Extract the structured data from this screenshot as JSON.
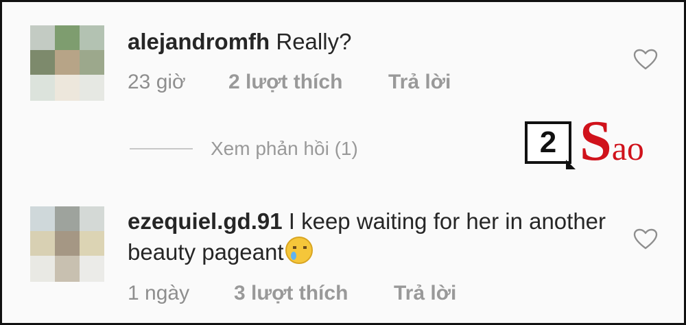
{
  "comments": [
    {
      "username": "alejandromfh",
      "text": "Really?",
      "time": "23 giờ",
      "likes": "2 lượt thích",
      "reply_label": "Trả lời",
      "avatar_colors": [
        "#c3cbc3",
        "#7e9d6f",
        "#b3c2b2",
        "#7d8a6c",
        "#b7a487",
        "#9ca88c",
        "#dce3dc",
        "#ede7dc",
        "#e6e8e3"
      ]
    },
    {
      "username": "ezequiel.gd.91",
      "text": "I keep waiting for her in another beauty pageant",
      "emoji": "crying-face",
      "time": "1 ngày",
      "likes": "3 lượt thích",
      "reply_label": "Trả lời",
      "avatar_colors": [
        "#cfd8da",
        "#9ea39d",
        "#d4d9d6",
        "#d8d0b3",
        "#a59784",
        "#dcd4b4",
        "#e9e9e4",
        "#c8c0b0",
        "#ebebe8"
      ]
    }
  ],
  "view_replies": "Xem phản hồi (1)",
  "watermark": {
    "box_text": "2",
    "word_big": "S",
    "word_small": "ao",
    "color": "#d0121b"
  },
  "icons": {
    "like": "heart-outline-icon"
  }
}
